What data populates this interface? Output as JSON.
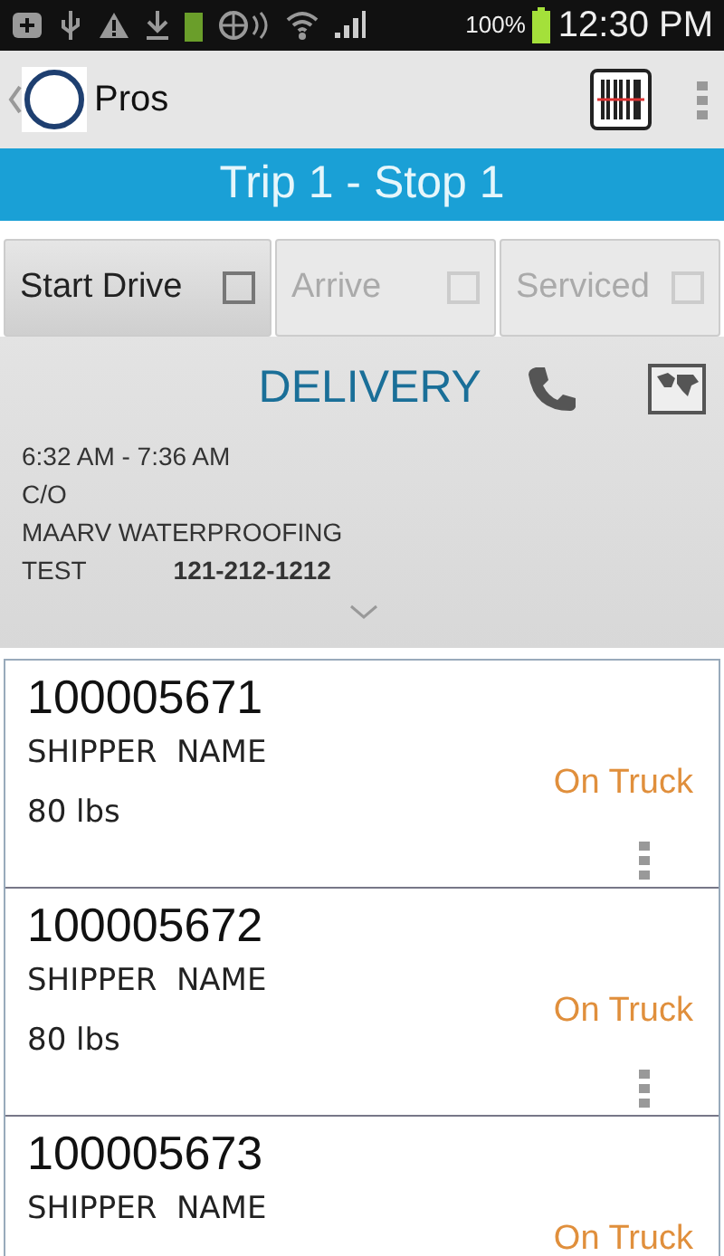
{
  "status_bar": {
    "battery": "100%",
    "time": "12:30 PM"
  },
  "app_bar": {
    "title": "Pros"
  },
  "header": {
    "title": "Trip 1 - Stop 1"
  },
  "actions": [
    {
      "label": "Start Drive",
      "disabled": false,
      "checked": false
    },
    {
      "label": "Arrive",
      "disabled": true,
      "checked": false
    },
    {
      "label": "Serviced",
      "disabled": true,
      "checked": false
    }
  ],
  "stop": {
    "type": "DELIVERY",
    "time_window": "6:32 AM - 7:36 AM",
    "care_of": "C/O",
    "company": "MAARV WATERPROOFING",
    "contact": "TEST",
    "phone": "121-212-1212"
  },
  "orders": [
    {
      "number": "100005671",
      "shipper": "SHIPPER  NAME",
      "weight": "80 lbs",
      "status": "On Truck"
    },
    {
      "number": "100005672",
      "shipper": "SHIPPER  NAME",
      "weight": "80 lbs",
      "status": "On Truck"
    },
    {
      "number": "100005673",
      "shipper": "SHIPPER  NAME",
      "status": "On Truck"
    }
  ]
}
